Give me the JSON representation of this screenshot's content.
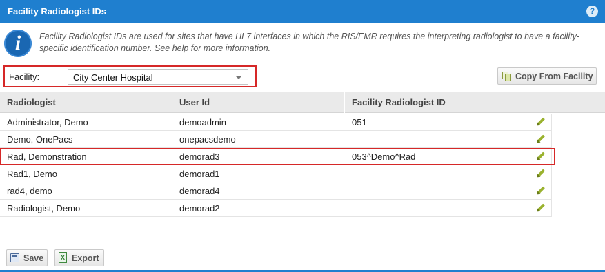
{
  "header": {
    "title": "Facility Radiologist IDs",
    "help_icon": "?"
  },
  "info": {
    "icon": "i",
    "text": "Facility Radiologist IDs are used for sites that have HL7 interfaces in which the RIS/EMR requires the interpreting radiologist to have a facility-specific identification number. See help for more information."
  },
  "facility": {
    "label": "Facility:",
    "selected": "City Center Hospital"
  },
  "toolbar": {
    "copy_label": "Copy From Facility"
  },
  "grid": {
    "columns": [
      "Radiologist",
      "User Id",
      "Facility Radiologist ID"
    ],
    "rows": [
      {
        "radiologist": "Administrator, Demo",
        "user_id": "demoadmin",
        "facility_id": "051"
      },
      {
        "radiologist": "Demo, OnePacs",
        "user_id": "onepacsdemo",
        "facility_id": ""
      },
      {
        "radiologist": "Rad, Demonstration",
        "user_id": "demorad3",
        "facility_id": "053^Demo^Rad"
      },
      {
        "radiologist": "Rad1, Demo",
        "user_id": "demorad1",
        "facility_id": ""
      },
      {
        "radiologist": "rad4, demo",
        "user_id": "demorad4",
        "facility_id": ""
      },
      {
        "radiologist": "Radiologist, Demo",
        "user_id": "demorad2",
        "facility_id": ""
      }
    ]
  },
  "footer": {
    "save_label": "Save",
    "export_label": "Export"
  },
  "colors": {
    "header_bg": "#1f7fcf",
    "highlight": "#d62828",
    "edit_icon": "#9ab22e"
  }
}
